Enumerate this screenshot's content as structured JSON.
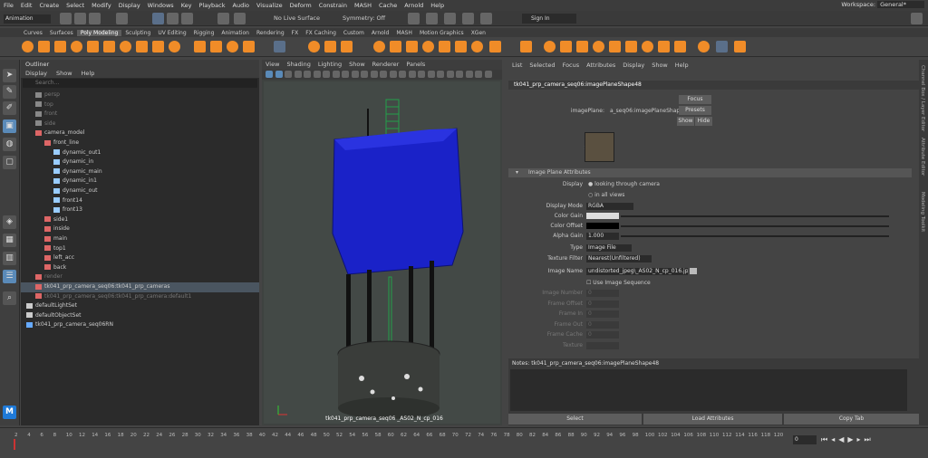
{
  "menubar": [
    "File",
    "Edit",
    "Create",
    "Select",
    "Modify",
    "Display",
    "Windows",
    "Key",
    "Playback",
    "Audio",
    "Visualize",
    "Deform",
    "Constrain",
    "MASH",
    "Cache",
    "Arnold",
    "Help"
  ],
  "workspace": {
    "label": "Workspace:",
    "value": "General*"
  },
  "status": {
    "mode": "Animation",
    "surface": "No Live Surface",
    "symmetry": "Symmetry: Off",
    "signin": "Sign In"
  },
  "shelftabs": [
    "Curves",
    "Surfaces",
    "Poly Modeling",
    "Sculpting",
    "UV Editing",
    "Rigging",
    "Animation",
    "Rendering",
    "FX",
    "FX Caching",
    "Custom",
    "Arnold",
    "MASH",
    "Motion Graphics",
    "XGen"
  ],
  "outliner": {
    "title": "Outliner",
    "menu": [
      "Display",
      "Show",
      "Help"
    ],
    "search_placeholder": "Search...",
    "rows": [
      {
        "label": "persp",
        "indent": 1,
        "type": "cam",
        "dim": true
      },
      {
        "label": "top",
        "indent": 1,
        "type": "cam",
        "dim": true
      },
      {
        "label": "front",
        "indent": 1,
        "type": "cam",
        "dim": true
      },
      {
        "label": "side",
        "indent": 1,
        "type": "cam",
        "dim": true
      },
      {
        "label": "camera_model",
        "indent": 1,
        "type": "grp"
      },
      {
        "label": "front_line",
        "indent": 2,
        "type": "grp"
      },
      {
        "label": "dynamic_out1",
        "indent": 3,
        "type": "crv"
      },
      {
        "label": "dynamic_in",
        "indent": 3,
        "type": "crv"
      },
      {
        "label": "dynamic_main",
        "indent": 3,
        "type": "crv"
      },
      {
        "label": "dynamic_in1",
        "indent": 3,
        "type": "crv"
      },
      {
        "label": "dynamic_out",
        "indent": 3,
        "type": "crv"
      },
      {
        "label": "front14",
        "indent": 3,
        "type": "crv"
      },
      {
        "label": "front13",
        "indent": 3,
        "type": "crv"
      },
      {
        "label": "side1",
        "indent": 2,
        "type": "grp"
      },
      {
        "label": "inside",
        "indent": 2,
        "type": "grp"
      },
      {
        "label": "main",
        "indent": 2,
        "type": "grp"
      },
      {
        "label": "top1",
        "indent": 2,
        "type": "grp"
      },
      {
        "label": "left_acc",
        "indent": 2,
        "type": "grp"
      },
      {
        "label": "back",
        "indent": 2,
        "type": "grp"
      },
      {
        "label": "render",
        "indent": 1,
        "type": "grp",
        "dim": true
      },
      {
        "label": "tk041_prp_camera_seq06:tk041_prp_cameras",
        "indent": 1,
        "type": "grp",
        "sel": true
      },
      {
        "label": "tk041_prp_camera_seq06:tk041_prp_camera:default1",
        "indent": 1,
        "type": "grp",
        "dim": true
      },
      {
        "label": "defaultLightSet",
        "indent": 0,
        "type": "set"
      },
      {
        "label": "defaultObjectSet",
        "indent": 0,
        "type": "set"
      },
      {
        "label": "tk041_prp_camera_seq06RN",
        "indent": 0,
        "type": "ref"
      }
    ]
  },
  "viewport": {
    "menu": [
      "View",
      "Shading",
      "Lighting",
      "Show",
      "Renderer",
      "Panels"
    ],
    "caption": "tk041_prp_camera_seq06 _AS02_N_cp_016"
  },
  "ae": {
    "menu": [
      "List",
      "Selected",
      "Focus",
      "Attributes",
      "Display",
      "Show",
      "Help"
    ],
    "node_tab": "tk041_prp_camera_seq06:imagePlaneShape48",
    "imageplane_label": "imagePlane:",
    "imageplane_value": "a_seq06:imagePlaneShape48",
    "focus": "Focus",
    "presets": "Presets",
    "show": "Show",
    "hide": "Hide",
    "sample": "Sample",
    "section": "Image Plane Attributes",
    "display_label": "Display",
    "display_opt1": "looking through camera",
    "display_opt2": "in all views",
    "mode_label": "Display Mode",
    "mode_value": "RGBA",
    "colorgain_label": "Color Gain",
    "coloroffset_label": "Color Offset",
    "alphagain_label": "Alpha Gain",
    "alphagain_value": "1.000",
    "type_label": "Type",
    "type_value": "Image File",
    "filter_label": "Texture Filter",
    "filter_value": "Nearest(Unfiltered)",
    "imagename_label": "Image Name",
    "imagename_value": "undistorted_jpeg\\_AS02_N_cp_016.jpeg",
    "useseq": "Use Image Sequence",
    "imagenumber": "Image Number",
    "frameoffset": "Frame Offset",
    "framein": "Frame In",
    "frameout": "Frame Out",
    "framecache": "Frame Cache",
    "texture": "Texture",
    "zero": "0",
    "zero2": "0",
    "zero3": "0",
    "zero4": "0",
    "zero5": "0",
    "notes": "Notes: tk041_prp_camera_seq06:imagePlaneShape48",
    "select": "Select",
    "load": "Load Attributes",
    "copytab": "Copy Tab"
  },
  "sidepanel": [
    "Channel Box / Layer Editor",
    "Attribute Editor",
    "Modeling Toolkit"
  ],
  "timeline": {
    "ticks": [
      "2",
      "4",
      "6",
      "8",
      "10",
      "12",
      "14",
      "16",
      "18",
      "20",
      "22",
      "24",
      "26",
      "28",
      "30",
      "32",
      "34",
      "36",
      "38",
      "40",
      "42",
      "44",
      "46",
      "48",
      "50",
      "52",
      "54",
      "56",
      "58",
      "60",
      "62",
      "64",
      "66",
      "68",
      "70",
      "72",
      "74",
      "76",
      "78",
      "80",
      "82",
      "84",
      "86",
      "88",
      "90",
      "92",
      "94",
      "96",
      "98",
      "100",
      "102",
      "104",
      "106",
      "108",
      "110",
      "112",
      "114",
      "116",
      "118",
      "120"
    ],
    "frame": "0"
  },
  "colors": {
    "accent": "#f08c28",
    "mesh_blue": "#1a22c8",
    "wire_green": "#23a04a"
  }
}
